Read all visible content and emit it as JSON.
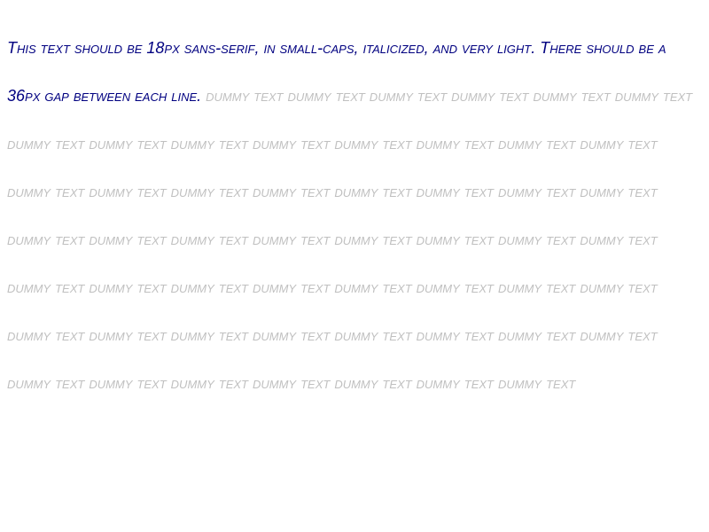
{
  "instruction_text": "This text should be 18px sans-serif, in small-caps, italicized, and very light. There should be a 36px gap between each line.",
  "dummy_text": "dummy text dummy text dummy text dummy text dummy text dummy text dummy text dummy text dummy text dummy text dummy text dummy text dummy text dummy text dummy text dummy text dummy text dummy text dummy text dummy text dummy text dummy text dummy text dummy text dummy text dummy text dummy text dummy text dummy text dummy text dummy text dummy text dummy text dummy text dummy text dummy text dummy text dummy text dummy text dummy text dummy text dummy text dummy text dummy text dummy text dummy text dummy text dummy text dummy text dummy text dummy text dummy text dummy text",
  "colors": {
    "instruction": "#000080",
    "dummy": "#c0c0c0",
    "background": "#ffffff"
  }
}
